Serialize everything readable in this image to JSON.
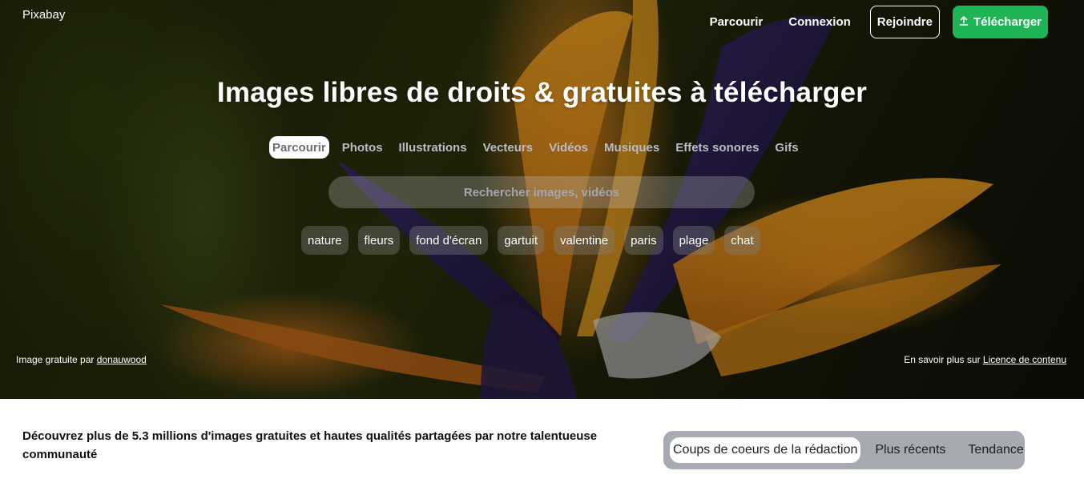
{
  "header": {
    "logo": "Pixabay",
    "nav": {
      "browse": "Parcourir",
      "login": "Connexion",
      "join": "Rejoindre",
      "upload": "Télécharger"
    }
  },
  "hero": {
    "title": "Images libres de droits & gratuites à télécharger",
    "type_tabs": [
      "Parcourir",
      "Photos",
      "Illustrations",
      "Vecteurs",
      "Vidéos",
      "Musiques",
      "Effets sonores",
      "Gifs"
    ],
    "active_tab": "Parcourir",
    "search": {
      "placeholder": "Rechercher images, vidéos",
      "value": ""
    },
    "tags": [
      "nature",
      "fleurs",
      "fond d'écran",
      "gartuit",
      "valentine",
      "paris",
      "plage",
      "chat"
    ],
    "credit": {
      "prefix": "Image gratuite par",
      "author": "donauwood"
    },
    "license": {
      "prefix": "En savoir plus sur",
      "link": "Licence de contenu"
    }
  },
  "main": {
    "tagline": "Découvrez plus de 5.3 millions d'images gratuites et hautes qualités partagées par notre talentueuse communauté",
    "sort": {
      "options": [
        "Coups de coeurs de la rédaction",
        "Plus récents",
        "Tendance"
      ],
      "selected": "Coups de coeurs de la rédaction"
    }
  },
  "colors": {
    "upload_button": "#1fb556",
    "sort_bar": "#a8aab3"
  },
  "icons": {
    "upload": "upload-arrow-icon"
  }
}
